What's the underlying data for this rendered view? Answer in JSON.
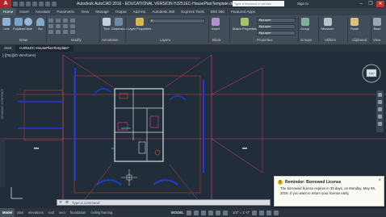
{
  "window": {
    "title": "Autodesk AutoCAD 2016 - EDUCATIONAL VERSION    HJ251EC-HousePlanTemplate.dwg",
    "search_placeholder": "Type a keyword or phrase",
    "signin": "Sign In"
  },
  "ribbon_tabs": [
    "Home",
    "Insert",
    "Annotate",
    "Parametric",
    "View",
    "Manage",
    "Output",
    "Add-ins",
    "Autodesk 360",
    "Express Tools",
    "BIM 360",
    "Featured Apps"
  ],
  "ribbon": {
    "tools": {
      "line": "Line",
      "polyline": "Polyline",
      "circle": "Circle",
      "arc": "Arc",
      "text": "Text",
      "dimension": "Dimension",
      "layer_properties": "Layer Properties",
      "insert": "Insert",
      "match_properties": "Match Properties",
      "group": "Group",
      "measure": "Measure",
      "paste": "Paste",
      "base": "Base"
    },
    "panels": [
      "Draw",
      "Modify",
      "Annotation",
      "Layers",
      "Block",
      "Properties",
      "Groups",
      "Utilities",
      "Clipboard",
      "View"
    ],
    "layer_value": "0",
    "bylayer": "ByLayer"
  },
  "file_tabs": [
    "Start",
    "HJ251EC-HousePlanTemplate*"
  ],
  "viewport": {
    "label": "[-][Top][2D Wireframe]",
    "viewcube_top": "TOP",
    "side_palette": "DRAWING INTERFACE"
  },
  "cmdline": {
    "prompt": "Type a command"
  },
  "notification": {
    "title": "Reminder: Borrowed License",
    "body": "The borrowed license expires in 39 days, on Monday, May 09, 2016. If you want to return your license early,"
  },
  "layout_tabs": [
    "Model",
    "plan",
    "elevations",
    "roof",
    "sect",
    "foundation",
    "ceiling framing"
  ],
  "status": {
    "mode": "MODEL",
    "scale": "1/4\" = 1'-0\""
  },
  "colors": {
    "background": "#212d38",
    "magenta": "#cf3b84",
    "red": "#d6453f",
    "blue": "#2537d6",
    "white": "#d8dde2",
    "cyan": "#35c6e0"
  }
}
